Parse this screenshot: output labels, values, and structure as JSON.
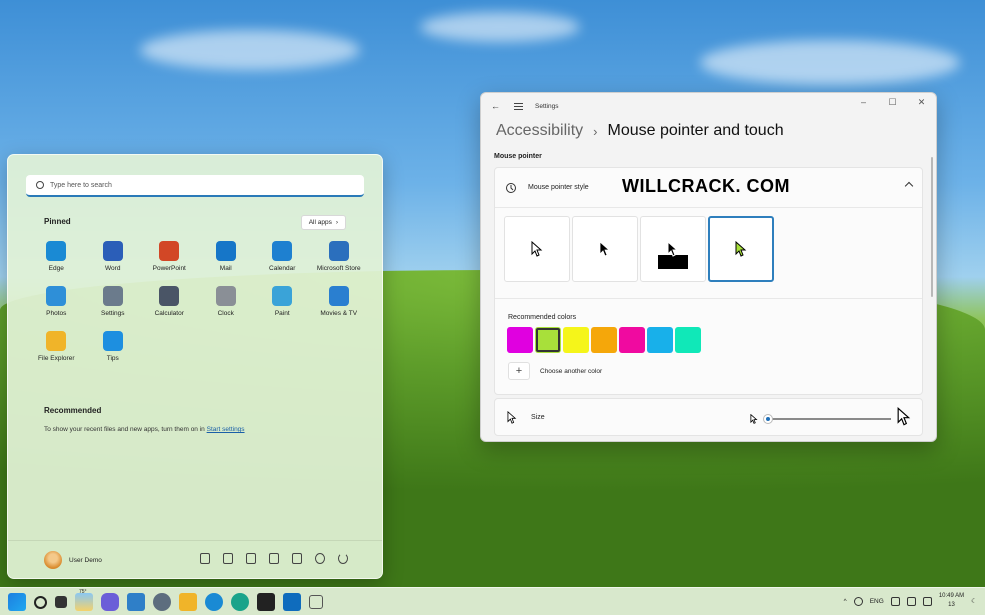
{
  "start_menu": {
    "search_placeholder": "Type here to search",
    "pinned_label": "Pinned",
    "all_apps_label": "All apps",
    "apps": [
      {
        "label": "Edge",
        "icon": "edge-icon",
        "color": "#1a8ad4"
      },
      {
        "label": "Word",
        "icon": "word-icon",
        "color": "#2b5eb8"
      },
      {
        "label": "PowerPoint",
        "icon": "powerpoint-icon",
        "color": "#d24726"
      },
      {
        "label": "Mail",
        "icon": "mail-icon",
        "color": "#1676c8"
      },
      {
        "label": "Calendar",
        "icon": "calendar-icon",
        "color": "#1e80d0"
      },
      {
        "label": "Microsoft Store",
        "icon": "store-icon",
        "color": "#2b6fbd"
      },
      {
        "label": "Photos",
        "icon": "photos-icon",
        "color": "#2e8fd8"
      },
      {
        "label": "Settings",
        "icon": "settings-icon",
        "color": "#6b7b8c"
      },
      {
        "label": "Calculator",
        "icon": "calculator-icon",
        "color": "#4a5566"
      },
      {
        "label": "Clock",
        "icon": "clock-icon",
        "color": "#8a8f96"
      },
      {
        "label": "Paint",
        "icon": "paint-icon",
        "color": "#3aa3d8"
      },
      {
        "label": "Movies & TV",
        "icon": "movies-icon",
        "color": "#2a7fd0"
      },
      {
        "label": "File Explorer",
        "icon": "folder-icon",
        "color": "#f0b429"
      },
      {
        "label": "Tips",
        "icon": "tips-icon",
        "color": "#1d8fe0"
      }
    ],
    "recommended_label": "Recommended",
    "recommended_text": "To show your recent files and new apps, turn them on in",
    "recommended_link": "Start settings",
    "user_name": "User Demo"
  },
  "settings": {
    "window_title": "Settings",
    "breadcrumb_parent": "Accessibility",
    "breadcrumb_sep": "›",
    "breadcrumb_current": "Mouse pointer and touch",
    "section_label": "Mouse pointer",
    "pointer_style_label": "Mouse pointer style",
    "watermark": "WILLCRACK. COM",
    "recommended_colors_label": "Recommended colors",
    "swatches": [
      "#e000e0",
      "#a8e03a",
      "#f5f51a",
      "#f5a70a",
      "#f00aa0",
      "#18b0ea",
      "#10e8b8"
    ],
    "selected_swatch": 1,
    "choose_color_label": "Choose another color",
    "size_label": "Size",
    "size_fraction": 0.0
  },
  "taskbar": {
    "weather_temp": "75°",
    "language": "ENG",
    "time": "10:49 AM",
    "date": "13"
  }
}
